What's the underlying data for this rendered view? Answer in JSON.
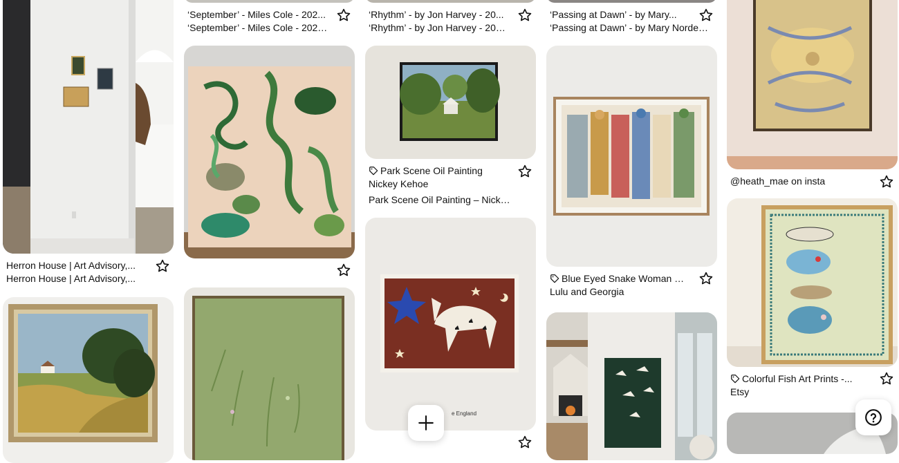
{
  "pins": {
    "herron": {
      "title": "Herron House | Art Advisory,...",
      "subtitle": "Herron House | Art Advisory,..."
    },
    "september": {
      "title": "‘September’ - Miles Cole - 202...",
      "subtitle": "‘September’ - Miles Cole - 2025 |..."
    },
    "rhythm": {
      "title": "‘Rhythm’ - by Jon Harvey - 20...",
      "subtitle": "‘Rhythm’ - by Jon Harvey - 2025 |..."
    },
    "passing": {
      "title": "‘Passing at Dawn’ - by Mary...",
      "subtitle": "‘Passing at Dawn’ - by Mary Norden ..."
    },
    "park": {
      "title": "Park Scene Oil Painting",
      "author": "Nickey Kehoe",
      "subtitle": "Park Scene Oil Painting – Nickey..."
    },
    "snake": {
      "title": "Blue Eyed Snake Woman Wa...",
      "author": "Lulu and Georgia"
    },
    "heath": {
      "title": "@heath_mae on insta"
    },
    "fish": {
      "title": "Colorful Fish Art Prints -...",
      "author": "Etsy"
    },
    "horse": {
      "caption": "e England"
    }
  },
  "icons": {
    "star": "star-outline-icon",
    "tag": "tag-icon",
    "plus": "plus-icon",
    "help": "help-icon"
  }
}
